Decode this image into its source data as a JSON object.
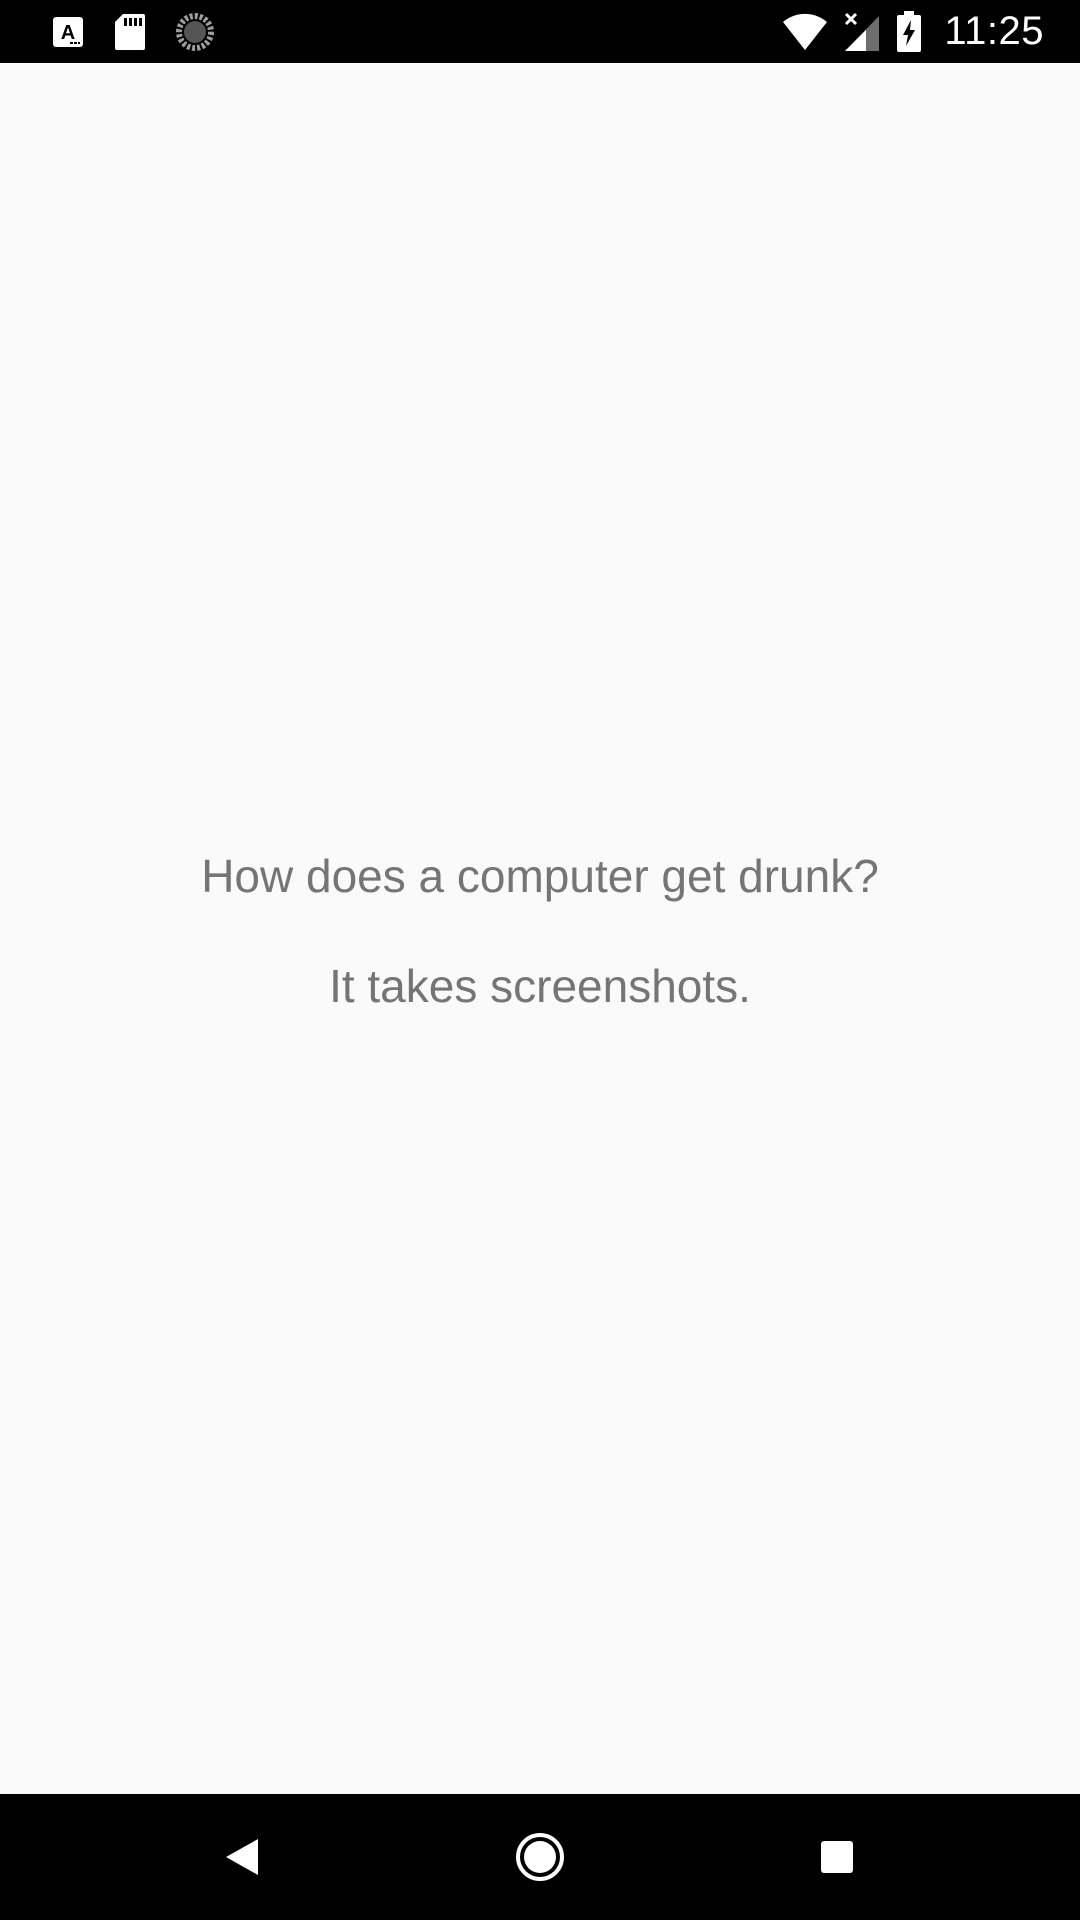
{
  "status_bar": {
    "time": "11:25",
    "left_icons": [
      "a-notification-icon",
      "sd-card-icon",
      "sync-progress-icon"
    ],
    "right_icons": [
      "wifi-icon",
      "cell-signal-no-data-icon",
      "battery-charging-icon"
    ]
  },
  "main": {
    "question": "How does a computer get drunk?",
    "answer": "It takes screenshots."
  },
  "nav_bar": {
    "buttons": [
      "back-icon",
      "home-icon",
      "recent-apps-icon"
    ]
  },
  "colors": {
    "background": "#fafafa",
    "text": "#757575",
    "bars": "#000000"
  }
}
